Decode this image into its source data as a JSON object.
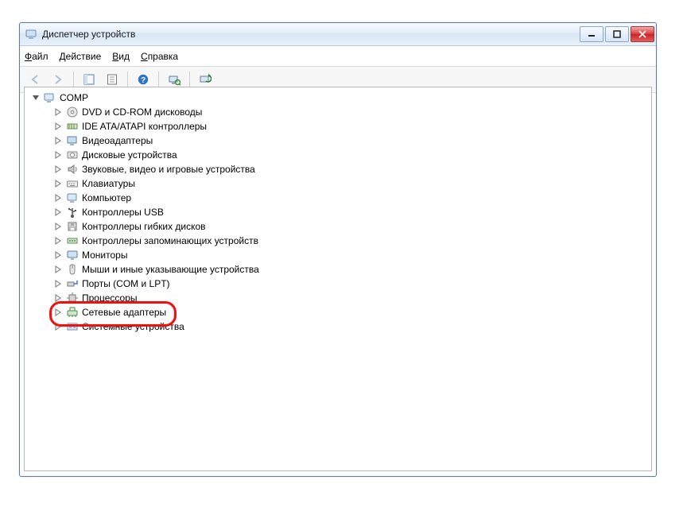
{
  "window": {
    "title": "Диспетчер устройств"
  },
  "menu": {
    "file": {
      "label": "Файл",
      "hotkey_index": 0
    },
    "action": {
      "label": "Действие",
      "hotkey_index": 0
    },
    "view": {
      "label": "Вид",
      "hotkey_index": 0
    },
    "help": {
      "label": "Справка",
      "hotkey_index": 0
    }
  },
  "tree": {
    "root": {
      "label": "COMP"
    },
    "items": [
      {
        "label": "DVD и CD-ROM дисководы",
        "icon": "optical-drive"
      },
      {
        "label": "IDE ATA/ATAPI контроллеры",
        "icon": "ide-controller"
      },
      {
        "label": "Видеоадаптеры",
        "icon": "display-adapter"
      },
      {
        "label": "Дисковые устройства",
        "icon": "disk-drive"
      },
      {
        "label": "Звуковые, видео и игровые устройства",
        "icon": "sound"
      },
      {
        "label": "Клавиатуры",
        "icon": "keyboard"
      },
      {
        "label": "Компьютер",
        "icon": "computer"
      },
      {
        "label": "Контроллеры USB",
        "icon": "usb"
      },
      {
        "label": "Контроллеры гибких дисков",
        "icon": "floppy-controller"
      },
      {
        "label": "Контроллеры запоминающих устройств",
        "icon": "storage-controller"
      },
      {
        "label": "Мониторы",
        "icon": "monitor"
      },
      {
        "label": "Мыши и иные указывающие устройства",
        "icon": "mouse"
      },
      {
        "label": "Порты (COM и LPT)",
        "icon": "port"
      },
      {
        "label": "Процессоры",
        "icon": "cpu"
      },
      {
        "label": "Сетевые адаптеры",
        "icon": "network-adapter",
        "highlighted": true
      },
      {
        "label": "Системные устройства",
        "icon": "system-device"
      }
    ]
  }
}
